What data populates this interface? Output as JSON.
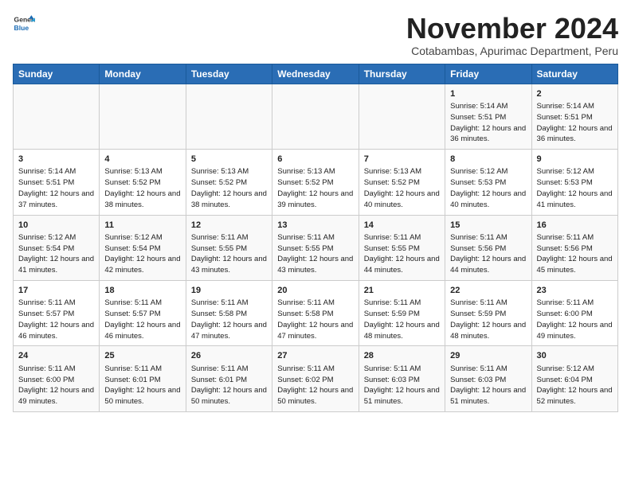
{
  "header": {
    "logo_line1": "General",
    "logo_line2": "Blue",
    "title": "November 2024",
    "subtitle": "Cotabambas, Apurimac Department, Peru"
  },
  "days_of_week": [
    "Sunday",
    "Monday",
    "Tuesday",
    "Wednesday",
    "Thursday",
    "Friday",
    "Saturday"
  ],
  "weeks": [
    [
      {
        "day": "",
        "info": ""
      },
      {
        "day": "",
        "info": ""
      },
      {
        "day": "",
        "info": ""
      },
      {
        "day": "",
        "info": ""
      },
      {
        "day": "",
        "info": ""
      },
      {
        "day": "1",
        "info": "Sunrise: 5:14 AM\nSunset: 5:51 PM\nDaylight: 12 hours and 36 minutes."
      },
      {
        "day": "2",
        "info": "Sunrise: 5:14 AM\nSunset: 5:51 PM\nDaylight: 12 hours and 36 minutes."
      }
    ],
    [
      {
        "day": "3",
        "info": "Sunrise: 5:14 AM\nSunset: 5:51 PM\nDaylight: 12 hours and 37 minutes."
      },
      {
        "day": "4",
        "info": "Sunrise: 5:13 AM\nSunset: 5:52 PM\nDaylight: 12 hours and 38 minutes."
      },
      {
        "day": "5",
        "info": "Sunrise: 5:13 AM\nSunset: 5:52 PM\nDaylight: 12 hours and 38 minutes."
      },
      {
        "day": "6",
        "info": "Sunrise: 5:13 AM\nSunset: 5:52 PM\nDaylight: 12 hours and 39 minutes."
      },
      {
        "day": "7",
        "info": "Sunrise: 5:13 AM\nSunset: 5:52 PM\nDaylight: 12 hours and 40 minutes."
      },
      {
        "day": "8",
        "info": "Sunrise: 5:12 AM\nSunset: 5:53 PM\nDaylight: 12 hours and 40 minutes."
      },
      {
        "day": "9",
        "info": "Sunrise: 5:12 AM\nSunset: 5:53 PM\nDaylight: 12 hours and 41 minutes."
      }
    ],
    [
      {
        "day": "10",
        "info": "Sunrise: 5:12 AM\nSunset: 5:54 PM\nDaylight: 12 hours and 41 minutes."
      },
      {
        "day": "11",
        "info": "Sunrise: 5:12 AM\nSunset: 5:54 PM\nDaylight: 12 hours and 42 minutes."
      },
      {
        "day": "12",
        "info": "Sunrise: 5:11 AM\nSunset: 5:55 PM\nDaylight: 12 hours and 43 minutes."
      },
      {
        "day": "13",
        "info": "Sunrise: 5:11 AM\nSunset: 5:55 PM\nDaylight: 12 hours and 43 minutes."
      },
      {
        "day": "14",
        "info": "Sunrise: 5:11 AM\nSunset: 5:55 PM\nDaylight: 12 hours and 44 minutes."
      },
      {
        "day": "15",
        "info": "Sunrise: 5:11 AM\nSunset: 5:56 PM\nDaylight: 12 hours and 44 minutes."
      },
      {
        "day": "16",
        "info": "Sunrise: 5:11 AM\nSunset: 5:56 PM\nDaylight: 12 hours and 45 minutes."
      }
    ],
    [
      {
        "day": "17",
        "info": "Sunrise: 5:11 AM\nSunset: 5:57 PM\nDaylight: 12 hours and 46 minutes."
      },
      {
        "day": "18",
        "info": "Sunrise: 5:11 AM\nSunset: 5:57 PM\nDaylight: 12 hours and 46 minutes."
      },
      {
        "day": "19",
        "info": "Sunrise: 5:11 AM\nSunset: 5:58 PM\nDaylight: 12 hours and 47 minutes."
      },
      {
        "day": "20",
        "info": "Sunrise: 5:11 AM\nSunset: 5:58 PM\nDaylight: 12 hours and 47 minutes."
      },
      {
        "day": "21",
        "info": "Sunrise: 5:11 AM\nSunset: 5:59 PM\nDaylight: 12 hours and 48 minutes."
      },
      {
        "day": "22",
        "info": "Sunrise: 5:11 AM\nSunset: 5:59 PM\nDaylight: 12 hours and 48 minutes."
      },
      {
        "day": "23",
        "info": "Sunrise: 5:11 AM\nSunset: 6:00 PM\nDaylight: 12 hours and 49 minutes."
      }
    ],
    [
      {
        "day": "24",
        "info": "Sunrise: 5:11 AM\nSunset: 6:00 PM\nDaylight: 12 hours and 49 minutes."
      },
      {
        "day": "25",
        "info": "Sunrise: 5:11 AM\nSunset: 6:01 PM\nDaylight: 12 hours and 50 minutes."
      },
      {
        "day": "26",
        "info": "Sunrise: 5:11 AM\nSunset: 6:01 PM\nDaylight: 12 hours and 50 minutes."
      },
      {
        "day": "27",
        "info": "Sunrise: 5:11 AM\nSunset: 6:02 PM\nDaylight: 12 hours and 50 minutes."
      },
      {
        "day": "28",
        "info": "Sunrise: 5:11 AM\nSunset: 6:03 PM\nDaylight: 12 hours and 51 minutes."
      },
      {
        "day": "29",
        "info": "Sunrise: 5:11 AM\nSunset: 6:03 PM\nDaylight: 12 hours and 51 minutes."
      },
      {
        "day": "30",
        "info": "Sunrise: 5:12 AM\nSunset: 6:04 PM\nDaylight: 12 hours and 52 minutes."
      }
    ]
  ]
}
